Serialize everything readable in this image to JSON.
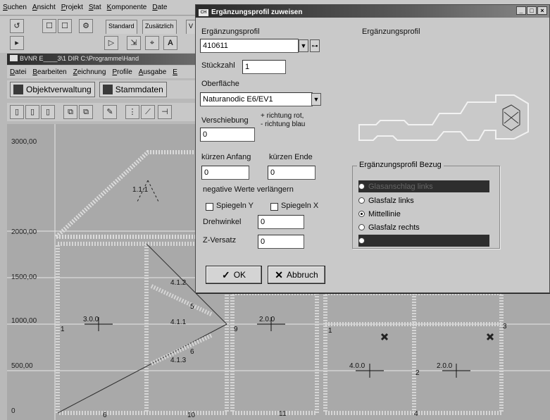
{
  "app_menu": [
    "Suchen",
    "Ansicht",
    "Projekt",
    "Stat",
    "Komponente",
    "Date"
  ],
  "toolbar_tabs": [
    "Standard",
    "Zusätzlich",
    "V"
  ],
  "child_window": {
    "title": "BVNR E____3\\1 DIR C:\\Programme\\Hand",
    "menu": [
      "Datei",
      "Bearbeiten",
      "Zeichnung",
      "Profile",
      "Ausgabe",
      "E"
    ],
    "toolbar_buttons": [
      "Objektverwaltung",
      "Stammdaten"
    ]
  },
  "drawing": {
    "y_labels": [
      "3000,00",
      "2000,00",
      "1500,00",
      "1000,00",
      "500,00",
      "0"
    ],
    "labels": [
      "1.1.1",
      "4.1.2",
      "5",
      "4.1.1",
      "3.0.0",
      "2.0.0",
      "6",
      "4.1.3",
      "4.0.0",
      "2.0.0",
      "1",
      "9",
      "6",
      "10",
      "11",
      "4",
      "1",
      "3",
      "2"
    ]
  },
  "dialog": {
    "title": "Ergänzungsprofil zuweisen",
    "labels": {
      "ergaenzungsprofil": "Ergänzungsprofil",
      "preview": "Ergänzungsprofil",
      "stueckzahl": "Stückzahl",
      "oberflaeche": "Oberfläche",
      "verschiebung": "Verschiebung",
      "richtung_rot": "+ richtung rot,",
      "richtung_blau": "- richtung blau",
      "kuerzen_anfang": "kürzen Anfang",
      "kuerzen_ende": "kürzen Ende",
      "negative": "negative Werte verlängern",
      "spiegeln_y": "Spiegeln Y",
      "spiegeln_x": "Spiegeln X",
      "drehwinkel": "Drehwinkel",
      "z_versatz": "Z-Versatz"
    },
    "values": {
      "ergaenzungsprofil": "410611",
      "stueckzahl": "1",
      "oberflaeche": "Naturanodic E6/EV1",
      "verschiebung": "0",
      "kuerzen_anfang": "0",
      "kuerzen_ende": "0",
      "drehwinkel": "0",
      "z_versatz": "0"
    },
    "bezug": {
      "legend": "Ergänzungsprofil Bezug",
      "options": [
        "Glasanschlag links",
        "Glasfalz links",
        "Mittellinie",
        "Glasfalz rechts",
        ""
      ],
      "selected_index": 2
    },
    "buttons": {
      "ok": "OK",
      "abbruch": "Abbruch"
    }
  }
}
